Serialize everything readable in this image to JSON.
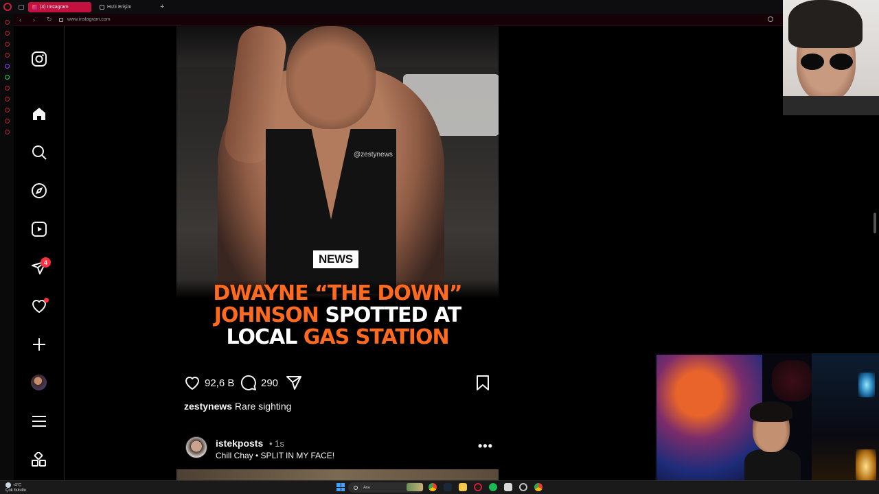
{
  "browser": {
    "tabs": [
      {
        "label": "(4) Instagram",
        "active": true
      },
      {
        "label": "Hızlı Erişim",
        "active": false
      }
    ],
    "new_tab_label": "+",
    "url": "www.instagram.com"
  },
  "sidebar": {
    "notifications_badge": "4",
    "items": [
      {
        "name": "instagram-logo-icon"
      },
      {
        "name": "home-icon"
      },
      {
        "name": "search-icon"
      },
      {
        "name": "explore-icon"
      },
      {
        "name": "reels-icon"
      },
      {
        "name": "messages-icon"
      },
      {
        "name": "heart-icon"
      },
      {
        "name": "create-icon"
      },
      {
        "name": "profile-avatar"
      },
      {
        "name": "menu-icon"
      },
      {
        "name": "apps-icon"
      }
    ]
  },
  "post": {
    "watermark": "@zestynews",
    "news_badge": "NEWS",
    "headline": {
      "line1": "DWAYNE “THE DOWN”",
      "line2_orange": "JOHNSON",
      "line2_white": " SPOTTED AT",
      "line3_white": "LOCAL ",
      "line3_orange": "GAS STATION"
    },
    "likes": "92,6 B",
    "comments": "290",
    "caption_user": "zestynews",
    "caption_text": " Rare sighting"
  },
  "next_post": {
    "username": "istekposts",
    "time": "• 1s",
    "audio": "Chill Chay • SPLIT IN MY FACE!",
    "more": "•••"
  },
  "taskbar": {
    "weather_temp": "-4°C",
    "weather_desc": "Çok bulutlu",
    "search_placeholder": "Ara"
  },
  "colors": {
    "opera_red": "#c2103f",
    "headline_orange": "#ff6a1f",
    "badge_red": "#ff3040"
  }
}
